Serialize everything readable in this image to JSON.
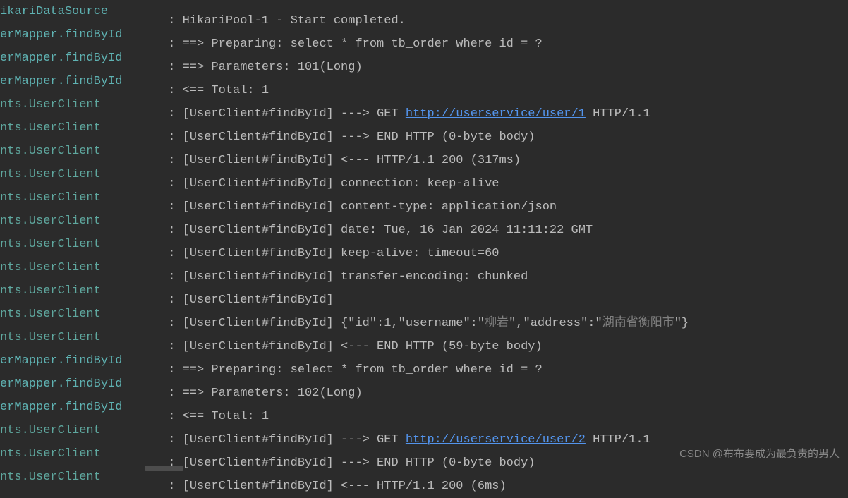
{
  "lines": [
    {
      "src": "ikariDataSource",
      "srcClass": "source",
      "msg": "HikariPool-1 - Start completed."
    },
    {
      "src": "erMapper.findById",
      "srcClass": "source",
      "msg": "==>  Preparing: select * from tb_order where id = ?"
    },
    {
      "src": "erMapper.findById",
      "srcClass": "source",
      "msg": "==> Parameters: 101(Long)"
    },
    {
      "src": "erMapper.findById",
      "srcClass": "source",
      "msg": "<==      Total: 1"
    },
    {
      "src": "nts.UserClient",
      "srcClass": "source-alt",
      "msg": "[UserClient#findById] ---> GET ",
      "link": "http://userservice/user/1",
      "msgAfter": " HTTP/1.1"
    },
    {
      "src": "nts.UserClient",
      "srcClass": "source-alt",
      "msg": "[UserClient#findById] ---> END HTTP (0-byte body)"
    },
    {
      "src": "nts.UserClient",
      "srcClass": "source-alt",
      "msg": "[UserClient#findById] <--- HTTP/1.1 200 (317ms)"
    },
    {
      "src": "nts.UserClient",
      "srcClass": "source-alt",
      "msg": "[UserClient#findById] connection: keep-alive"
    },
    {
      "src": "nts.UserClient",
      "srcClass": "source-alt",
      "msg": "[UserClient#findById] content-type: application/json"
    },
    {
      "src": "nts.UserClient",
      "srcClass": "source-alt",
      "msg": "[UserClient#findById] date: Tue, 16 Jan 2024 11:11:22 GMT"
    },
    {
      "src": "nts.UserClient",
      "srcClass": "source-alt",
      "msg": "[UserClient#findById] keep-alive: timeout=60"
    },
    {
      "src": "nts.UserClient",
      "srcClass": "source-alt",
      "msg": "[UserClient#findById] transfer-encoding: chunked"
    },
    {
      "src": "nts.UserClient",
      "srcClass": "source-alt",
      "msg": "[UserClient#findById] "
    },
    {
      "src": "nts.UserClient",
      "srcClass": "source-alt",
      "msg": "[UserClient#findById] {\"id\":1,\"username\":\"",
      "cn1": "柳岩",
      "mid": "\",\"address\":\"",
      "cn2": "湖南省衡阳市",
      "end": "\"}"
    },
    {
      "src": "nts.UserClient",
      "srcClass": "source-alt",
      "msg": "[UserClient#findById] <--- END HTTP (59-byte body)"
    },
    {
      "src": "erMapper.findById",
      "srcClass": "source",
      "msg": "==>  Preparing: select * from tb_order where id = ?"
    },
    {
      "src": "erMapper.findById",
      "srcClass": "source",
      "msg": "==> Parameters: 102(Long)"
    },
    {
      "src": "erMapper.findById",
      "srcClass": "source",
      "msg": "<==      Total: 1"
    },
    {
      "src": "nts.UserClient",
      "srcClass": "source-alt",
      "msg": "[UserClient#findById] ---> GET ",
      "link": "http://userservice/user/2",
      "msgAfter": " HTTP/1.1"
    },
    {
      "src": "nts.UserClient",
      "srcClass": "source-alt",
      "msg": "[UserClient#findById] ---> END HTTP (0-byte body)"
    },
    {
      "src": "nts.UserClient",
      "srcClass": "source-alt",
      "msg": "[UserClient#findById] <--- HTTP/1.1 200 (6ms)"
    }
  ],
  "separator": "   : ",
  "watermark": "CSDN @布布要成为最负责的男人"
}
